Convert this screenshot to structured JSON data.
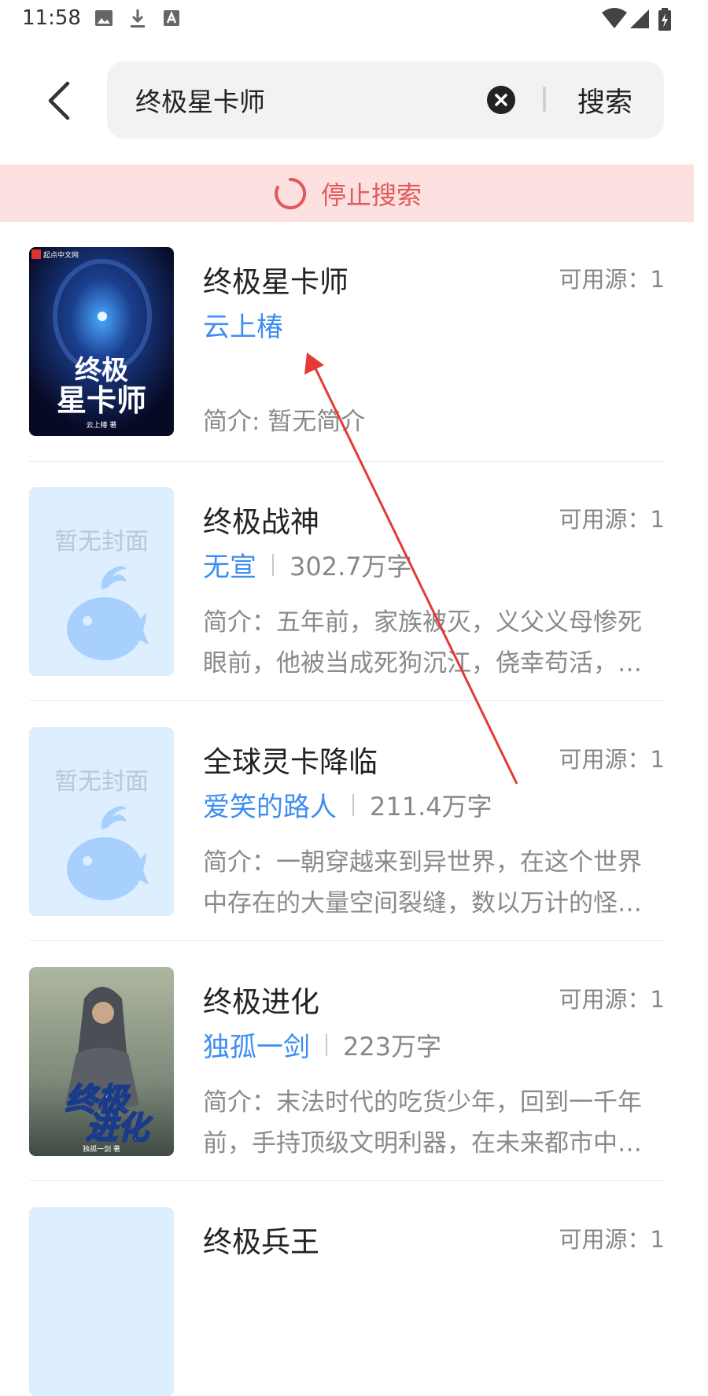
{
  "status_bar": {
    "time": "11:58"
  },
  "search": {
    "query": "终极星卡师",
    "search_label": "搜索"
  },
  "banner": {
    "stop_label": "停止搜索"
  },
  "colors": {
    "accent": "#3d8ef0",
    "banner_bg": "#fde0e0",
    "banner_text": "#e15a5a",
    "annotation_arrow": "#e53935"
  },
  "books": [
    {
      "title": "终极星卡师",
      "sources": "可用源：1",
      "author": "云上椿",
      "word_count": "",
      "intro": "简介: 暂无简介",
      "cover_text": [
        "起点中文网",
        "终极",
        "星卡师",
        "云上椿 著"
      ]
    },
    {
      "title": "终极战神",
      "sources": "可用源：1",
      "author": "无宣",
      "word_count": "302.7万字",
      "intro": "简介：五年前，家族被灭，义父义母惨死眼前，他被当成死狗沉江，侥幸苟活，却被迫走上一条复仇之路",
      "cover_placeholder": "暂无封面"
    },
    {
      "title": "全球灵卡降临",
      "sources": "可用源：1",
      "author": "爱笑的路人",
      "word_count": "211.4万字",
      "intro": "简介：一朝穿越来到异世界，在这个世界中存在的大量空间裂缝，数以万计的怪物从中涌出",
      "cover_placeholder": "暂无封面"
    },
    {
      "title": "终极进化",
      "sources": "可用源：1",
      "author": "独孤一剑",
      "word_count": "223万字",
      "intro": "简介：末法时代的吃货少年，回到一千年前，手持顶级文明利器，在未来都市中崛起",
      "cover_text": [
        "终极",
        "进化",
        "独孤一剑 著"
      ]
    },
    {
      "title": "终极兵王",
      "sources": "可用源：1"
    }
  ]
}
